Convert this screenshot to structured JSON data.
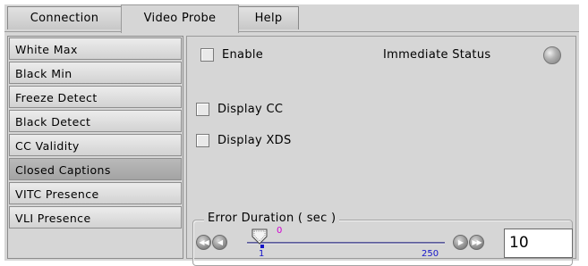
{
  "tabs": [
    {
      "label": "Connection",
      "active": false
    },
    {
      "label": "Video Probe",
      "active": true
    },
    {
      "label": "Help",
      "active": false
    }
  ],
  "sidebar": {
    "items": [
      {
        "label": "White Max",
        "selected": false
      },
      {
        "label": "Black Min",
        "selected": false
      },
      {
        "label": "Freeze Detect",
        "selected": false
      },
      {
        "label": "Black Detect",
        "selected": false
      },
      {
        "label": "CC Validity",
        "selected": false
      },
      {
        "label": "Closed Captions",
        "selected": true
      },
      {
        "label": "VITC Presence",
        "selected": false
      },
      {
        "label": "VLI Presence",
        "selected": false
      }
    ]
  },
  "main": {
    "enable_label": "Enable",
    "enable_checked": false,
    "immediate_status_label": "Immediate Status",
    "status_led_color": "#a8a8a8",
    "display_cc_label": "Display CC",
    "display_cc_checked": false,
    "display_xds_label": "Display XDS",
    "display_xds_checked": false,
    "error_duration": {
      "title": "Error Duration ( sec )",
      "min_label": "1",
      "max_label": "250",
      "thumb_value": "0",
      "value_field": "10",
      "value": 10
    }
  },
  "icons": {
    "first": "rewind-icon",
    "prev": "step-back-icon",
    "next": "step-forward-icon",
    "last": "fast-forward-icon"
  },
  "colors": {
    "panel_bg": "#d6d6d6",
    "track": "#5a5a9a",
    "tick_label": "#1414c8",
    "thumb_value": "#d000d0"
  }
}
